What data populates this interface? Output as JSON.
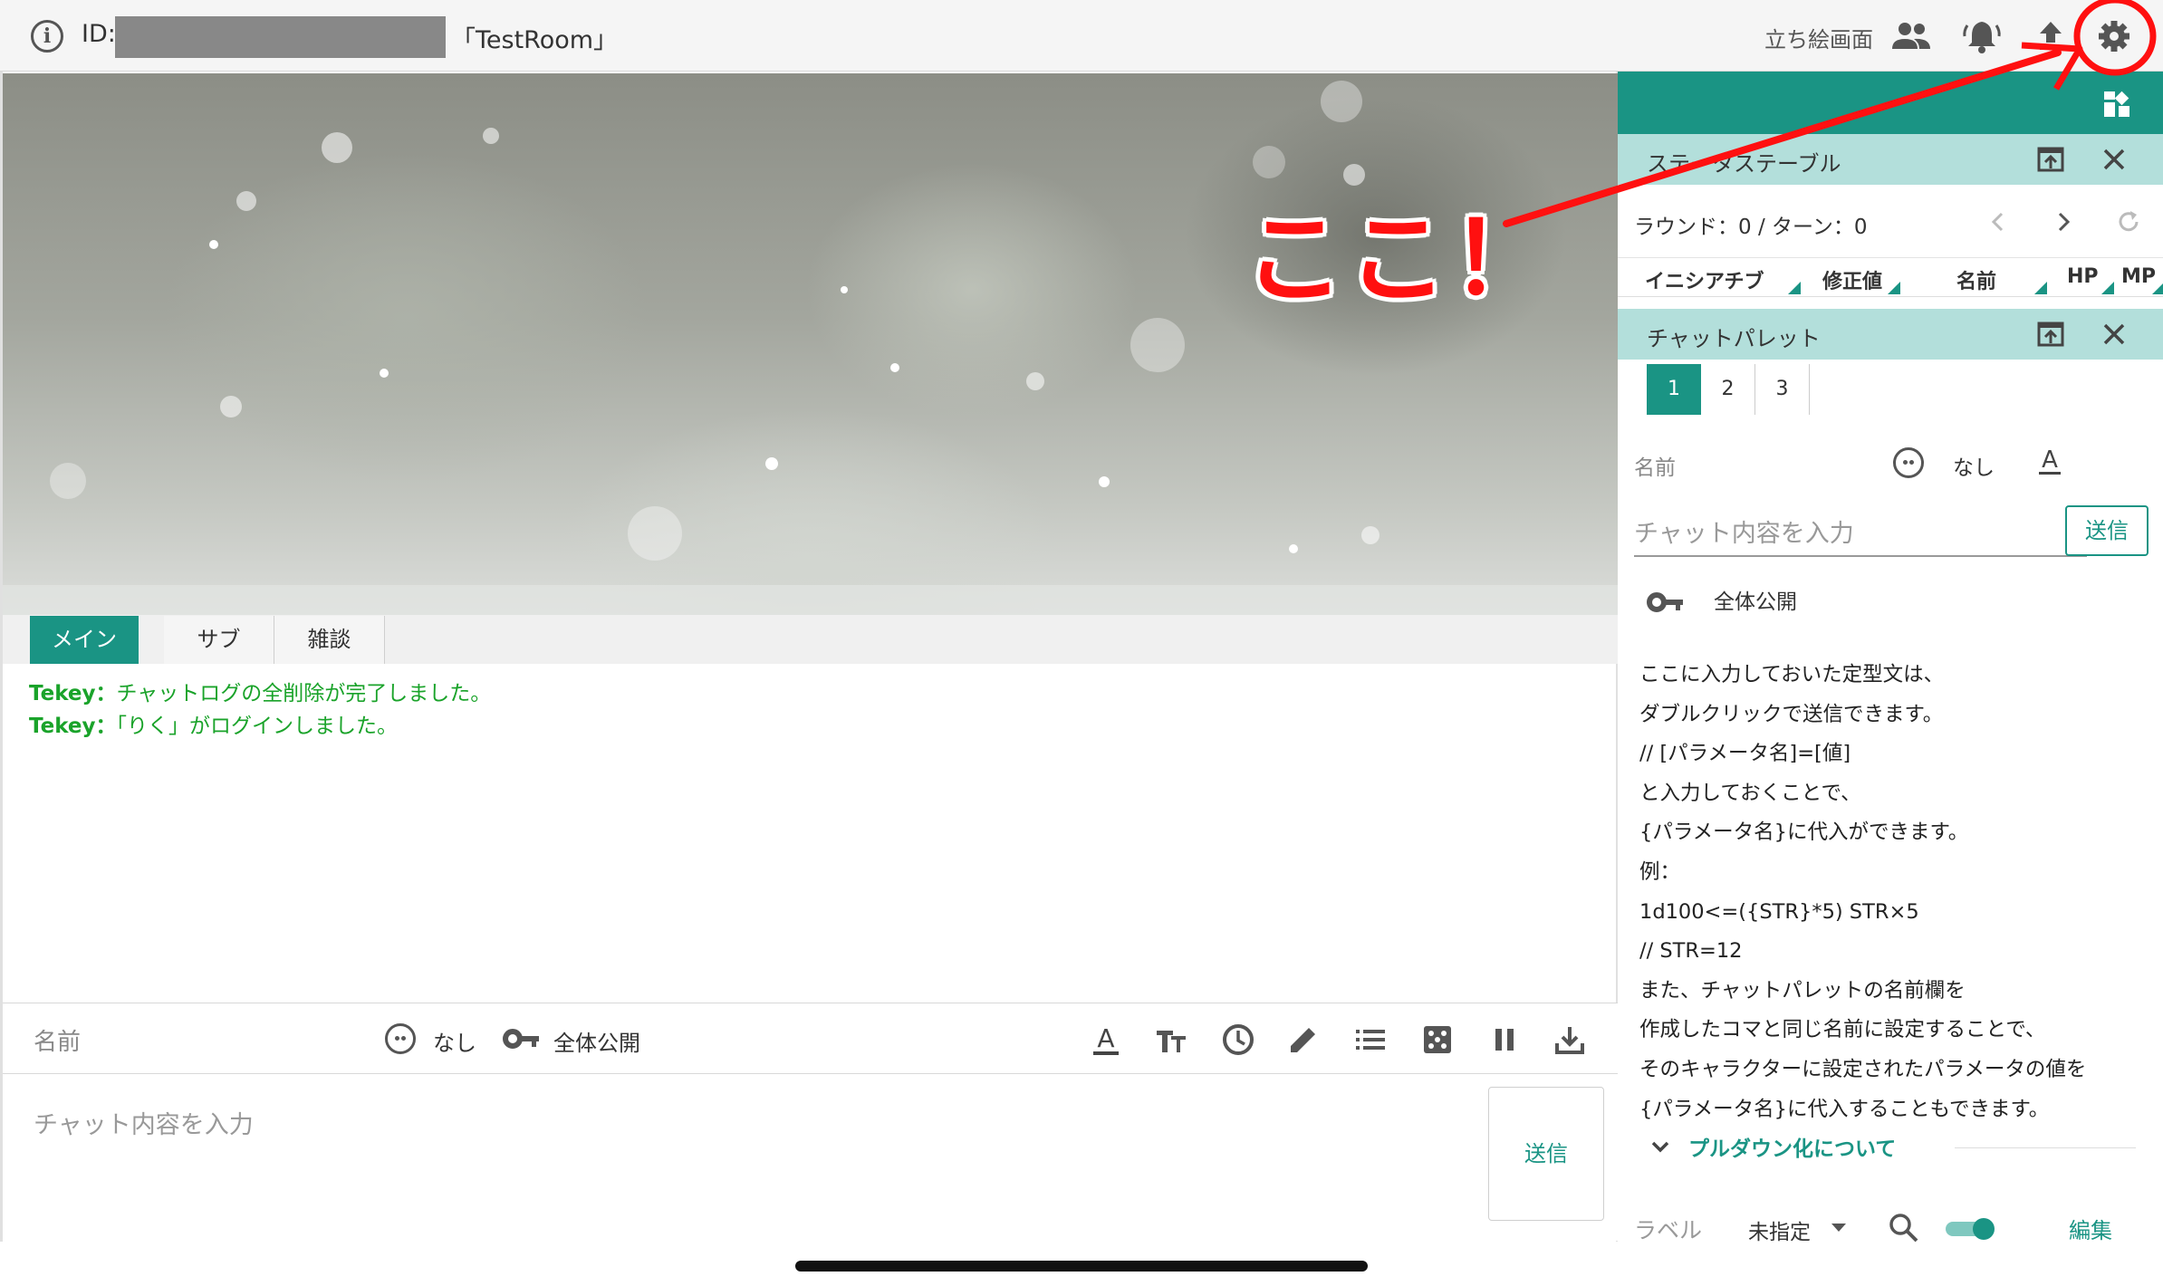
{
  "topbar": {
    "id_label": "ID:",
    "room_name": "「TestRoom」",
    "standing_label": "立ち絵画面",
    "icons": [
      "info-icon",
      "users-icon",
      "bell-icon",
      "upload-icon",
      "settings-icon"
    ]
  },
  "main": {
    "tabs": [
      {
        "label": "メイン",
        "active": true
      },
      {
        "label": "サブ",
        "active": false
      },
      {
        "label": "雑談",
        "active": false
      }
    ],
    "chatlog": [
      {
        "who": "Tekey：",
        "text": "チャットログの全削除が完了しました。"
      },
      {
        "who": "Tekey：",
        "text": "「りく」がログインしました。"
      }
    ],
    "chatlog_color": "#1aa32a",
    "input": {
      "name_placeholder": "名前",
      "character": "なし",
      "visibility": "全体公開",
      "message_placeholder": "チャット内容を入力",
      "send_label": "送信",
      "tools": [
        "text-color-icon",
        "font-size-icon",
        "clock-icon",
        "pencil-icon",
        "list-icon",
        "dice-icon",
        "pause-icon",
        "download-icon"
      ]
    }
  },
  "right_panel": {
    "accent_color": "#1a9484",
    "status_table": {
      "title": "ステータステーブル",
      "round_turn": "ラウンド：0 / ターン：0",
      "columns": [
        "イニシアチブ",
        "修正値",
        "名前",
        "HP",
        "MP"
      ]
    },
    "chat_palette": {
      "title": "チャットパレット",
      "tabs": [
        "1",
        "2",
        "3"
      ],
      "active_tab": "1",
      "name_placeholder": "名前",
      "character": "なし",
      "message_placeholder": "チャット内容を入力",
      "send_label": "送信",
      "visibility": "全体公開",
      "help_lines": [
        "ここに入力しておいた定型文は、",
        "ダブルクリックで送信できます。",
        "// [パラメータ名]=[値]",
        "と入力しておくことで、",
        "{パラメータ名}に代入ができます。",
        "例：",
        "1d100<=({STR}*5) STR×5",
        "// STR=12",
        "また、チャットパレットの名前欄を",
        "作成したコマと同じ名前に設定することで、",
        "そのキャラクターに設定されたパラメータの値を",
        "{パラメータ名}に代入することもできます。"
      ],
      "dropdown_label": "プルダウン化について",
      "label_label": "ラベル",
      "label_value": "未指定",
      "edit_label": "編集"
    }
  },
  "annotation": {
    "text": "ここ！",
    "color": "#ff1010"
  }
}
